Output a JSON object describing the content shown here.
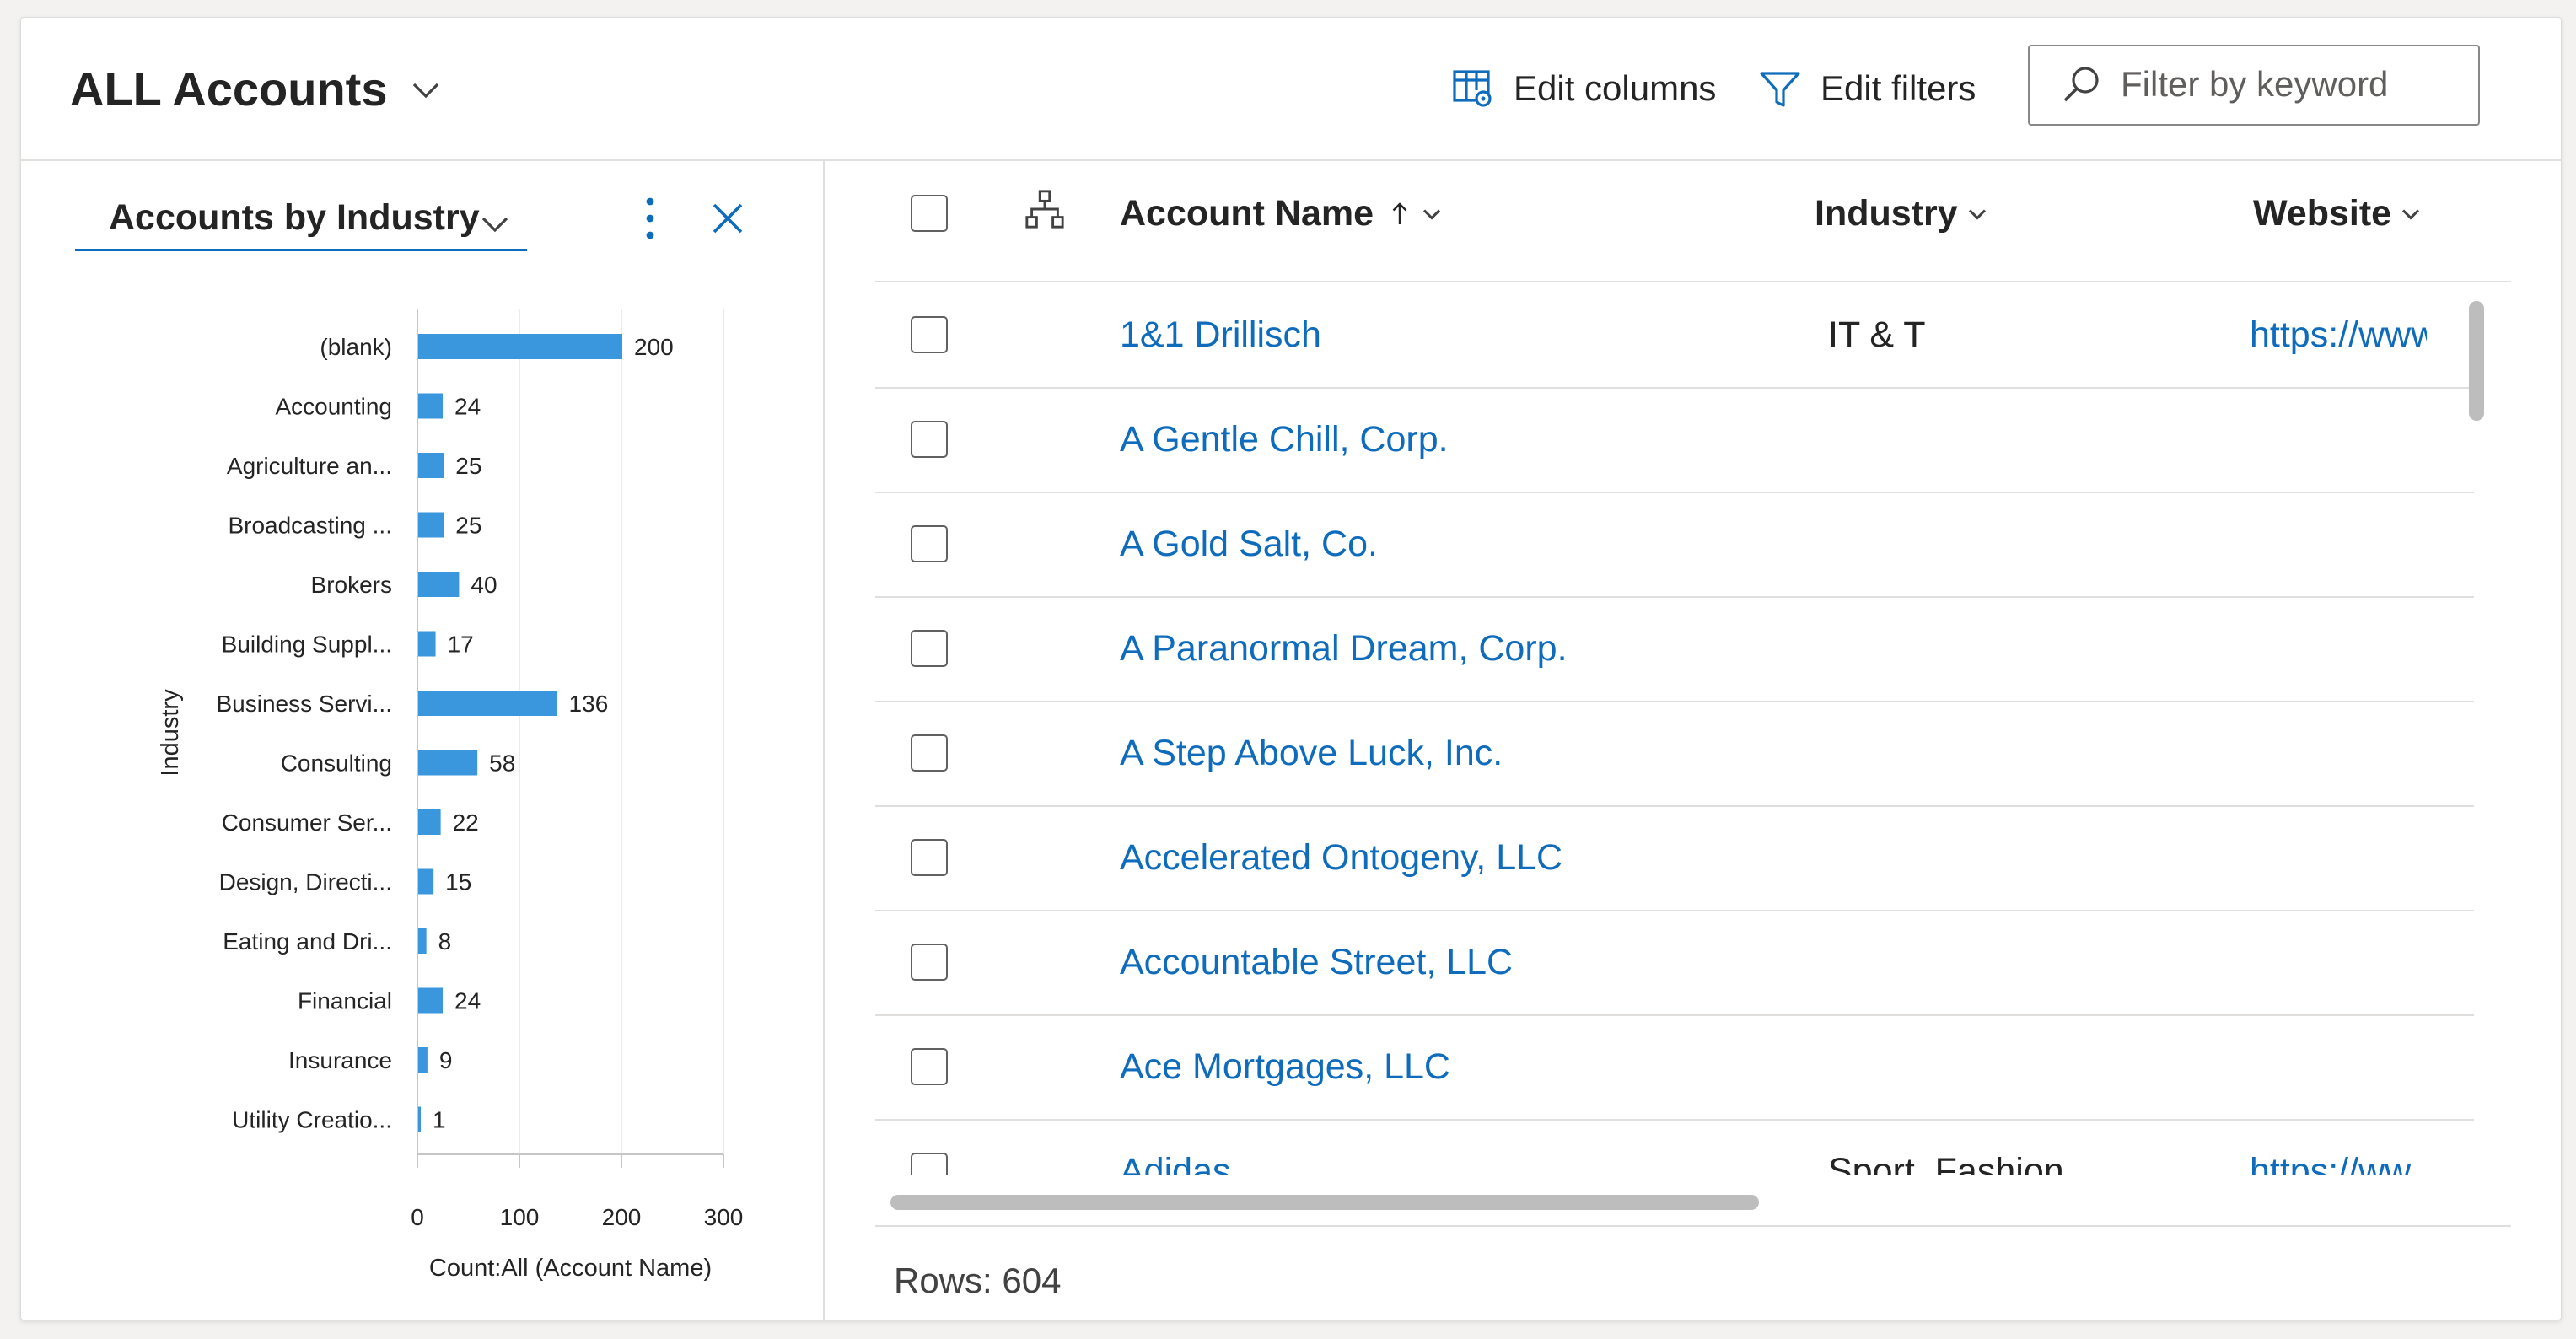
{
  "header": {
    "view_title": "ALL Accounts",
    "edit_columns_label": "Edit columns",
    "edit_filters_label": "Edit filters",
    "search_placeholder": "Filter by keyword"
  },
  "chart_pane": {
    "chart_selector_label": "Accounts by Industry"
  },
  "chart_data": {
    "type": "bar",
    "orientation": "horizontal",
    "categories": [
      "(blank)",
      "Accounting",
      "Agriculture an...",
      "Broadcasting ...",
      "Brokers",
      "Building Suppl...",
      "Business Servi...",
      "Consulting",
      "Consumer Ser...",
      "Design, Directi...",
      "Eating and Dri...",
      "Financial",
      "Insurance",
      "Utility Creatio..."
    ],
    "values": [
      200,
      24,
      25,
      25,
      40,
      17,
      136,
      58,
      22,
      15,
      8,
      24,
      9,
      1
    ],
    "xlabel": "Count:All (Account Name)",
    "ylabel": "Industry",
    "xlim": [
      0,
      300
    ],
    "xticks": [
      "0",
      "100",
      "200",
      "300"
    ],
    "grid": true,
    "bar_color": "#3a96dd"
  },
  "grid": {
    "columns": {
      "account_name": "Account Name",
      "industry": "Industry",
      "website": "Website"
    },
    "rows": [
      {
        "name": "1&1 Drillisch",
        "industry": "IT & T",
        "website": "https://www"
      },
      {
        "name": "A Gentle Chill, Corp.",
        "industry": "",
        "website": ""
      },
      {
        "name": "A Gold Salt, Co.",
        "industry": "",
        "website": ""
      },
      {
        "name": "A Paranormal Dream, Corp.",
        "industry": "",
        "website": ""
      },
      {
        "name": "A Step Above Luck, Inc.",
        "industry": "",
        "website": ""
      },
      {
        "name": "Accelerated Ontogeny, LLC",
        "industry": "",
        "website": ""
      },
      {
        "name": "Accountable Street, LLC",
        "industry": "",
        "website": ""
      },
      {
        "name": "Ace Mortgages, LLC",
        "industry": "",
        "website": ""
      },
      {
        "name": "Adidas",
        "industry": "Sport, Fashion",
        "website": "https://ww"
      }
    ],
    "rows_count": "Rows: 604"
  }
}
